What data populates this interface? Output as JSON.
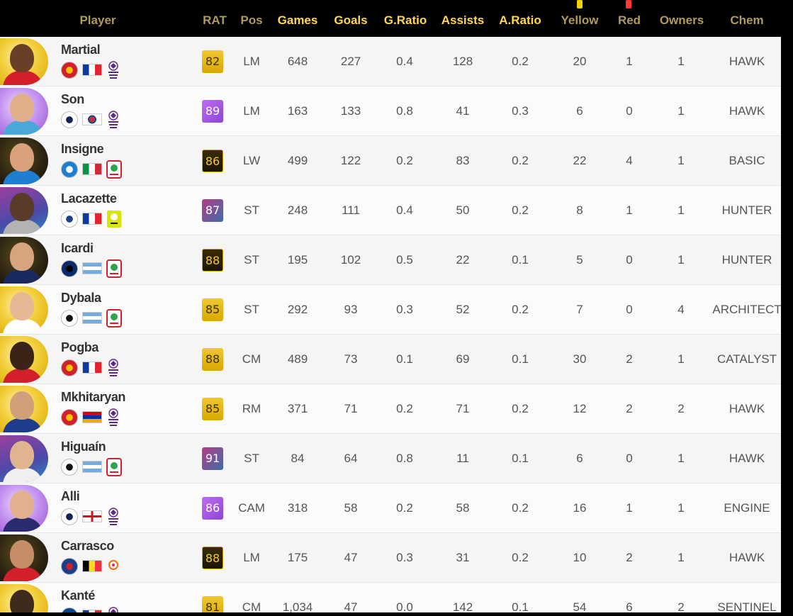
{
  "columns": {
    "player": "Player",
    "rat": "RAT",
    "pos": "Pos",
    "games": "Games",
    "goals": "Goals",
    "gratio": "G.Ratio",
    "assists": "Assists",
    "aratio": "A.Ratio",
    "yellow": "Yellow",
    "red": "Red",
    "owners": "Owners",
    "chem": "Chem"
  },
  "colors": {
    "header_bg": "#000000",
    "header_dim": "#b09a5c",
    "header_bright": "#ffd65a",
    "row_odd": "#f5f5f5",
    "row_even": "#fbfbfb"
  },
  "players": [
    {
      "name": "Martial",
      "rat": "82",
      "card": "gold",
      "pos": "LM",
      "games": "648",
      "goals": "227",
      "gratio": "0.4",
      "assists": "128",
      "aratio": "0.2",
      "yellow": "20",
      "red": "1",
      "owners": "1",
      "chem": "HAWK",
      "club": "manchester-united-crest",
      "flag": "france-flag",
      "league": "premier-league-logo"
    },
    {
      "name": "Son",
      "rat": "89",
      "card": "purple",
      "pos": "LM",
      "games": "163",
      "goals": "133",
      "gratio": "0.8",
      "assists": "41",
      "aratio": "0.3",
      "yellow": "6",
      "red": "0",
      "owners": "1",
      "chem": "HAWK",
      "club": "tottenham-crest",
      "flag": "south-korea-flag",
      "league": "premier-league-logo"
    },
    {
      "name": "Insigne",
      "rat": "86",
      "card": "dark",
      "pos": "LW",
      "games": "499",
      "goals": "122",
      "gratio": "0.2",
      "assists": "83",
      "aratio": "0.2",
      "yellow": "22",
      "red": "4",
      "owners": "1",
      "chem": "BASIC",
      "club": "napoli-crest",
      "flag": "italy-flag",
      "league": "calcio-a-logo"
    },
    {
      "name": "Lacazette",
      "rat": "87",
      "card": "grad",
      "pos": "ST",
      "games": "248",
      "goals": "111",
      "gratio": "0.4",
      "assists": "50",
      "aratio": "0.2",
      "yellow": "8",
      "red": "1",
      "owners": "1",
      "chem": "HUNTER",
      "club": "lyon-crest",
      "flag": "france-flag",
      "league": "ligue-1-logo"
    },
    {
      "name": "Icardi",
      "rat": "88",
      "card": "dark",
      "pos": "ST",
      "games": "195",
      "goals": "102",
      "gratio": "0.5",
      "assists": "22",
      "aratio": "0.1",
      "yellow": "5",
      "red": "0",
      "owners": "1",
      "chem": "HUNTER",
      "club": "inter-crest",
      "flag": "argentina-flag",
      "league": "calcio-a-logo"
    },
    {
      "name": "Dybala",
      "rat": "85",
      "card": "gold",
      "pos": "ST",
      "games": "292",
      "goals": "93",
      "gratio": "0.3",
      "assists": "52",
      "aratio": "0.2",
      "yellow": "7",
      "red": "0",
      "owners": "4",
      "chem": "ARCHITECT",
      "club": "juventus-crest",
      "flag": "argentina-flag",
      "league": "calcio-a-logo"
    },
    {
      "name": "Pogba",
      "rat": "88",
      "card": "gold",
      "pos": "CM",
      "games": "489",
      "goals": "73",
      "gratio": "0.1",
      "assists": "69",
      "aratio": "0.1",
      "yellow": "30",
      "red": "2",
      "owners": "1",
      "chem": "CATALYST",
      "club": "manchester-united-crest",
      "flag": "france-flag",
      "league": "premier-league-logo"
    },
    {
      "name": "Mkhitaryan",
      "rat": "85",
      "card": "gold",
      "pos": "RM",
      "games": "371",
      "goals": "71",
      "gratio": "0.2",
      "assists": "71",
      "aratio": "0.2",
      "yellow": "12",
      "red": "2",
      "owners": "2",
      "chem": "HAWK",
      "club": "manchester-united-crest",
      "flag": "armenia-flag",
      "league": "premier-league-logo"
    },
    {
      "name": "Higuaín",
      "rat": "91",
      "card": "grad",
      "pos": "ST",
      "games": "84",
      "goals": "64",
      "gratio": "0.8",
      "assists": "11",
      "aratio": "0.1",
      "yellow": "6",
      "red": "0",
      "owners": "1",
      "chem": "HAWK",
      "club": "juventus-crest",
      "flag": "argentina-flag",
      "league": "calcio-a-logo"
    },
    {
      "name": "Alli",
      "rat": "86",
      "card": "purple",
      "pos": "CAM",
      "games": "318",
      "goals": "58",
      "gratio": "0.2",
      "assists": "58",
      "aratio": "0.2",
      "yellow": "16",
      "red": "1",
      "owners": "1",
      "chem": "ENGINE",
      "club": "tottenham-crest",
      "flag": "england-flag",
      "league": "premier-league-logo"
    },
    {
      "name": "Carrasco",
      "rat": "88",
      "card": "dark",
      "pos": "LM",
      "games": "175",
      "goals": "47",
      "gratio": "0.3",
      "assists": "31",
      "aratio": "0.2",
      "yellow": "10",
      "red": "2",
      "owners": "1",
      "chem": "HAWK",
      "club": "atletico-madrid-crest",
      "flag": "belgium-flag",
      "league": "laliga-logo"
    },
    {
      "name": "Kanté",
      "rat": "81",
      "card": "gold",
      "pos": "CM",
      "games": "1,034",
      "goals": "47",
      "gratio": "0.0",
      "assists": "142",
      "aratio": "0.1",
      "yellow": "54",
      "red": "6",
      "owners": "2",
      "chem": "SENTINEL",
      "club": "chelsea-crest",
      "flag": "france-flag",
      "league": "premier-league-logo"
    }
  ]
}
